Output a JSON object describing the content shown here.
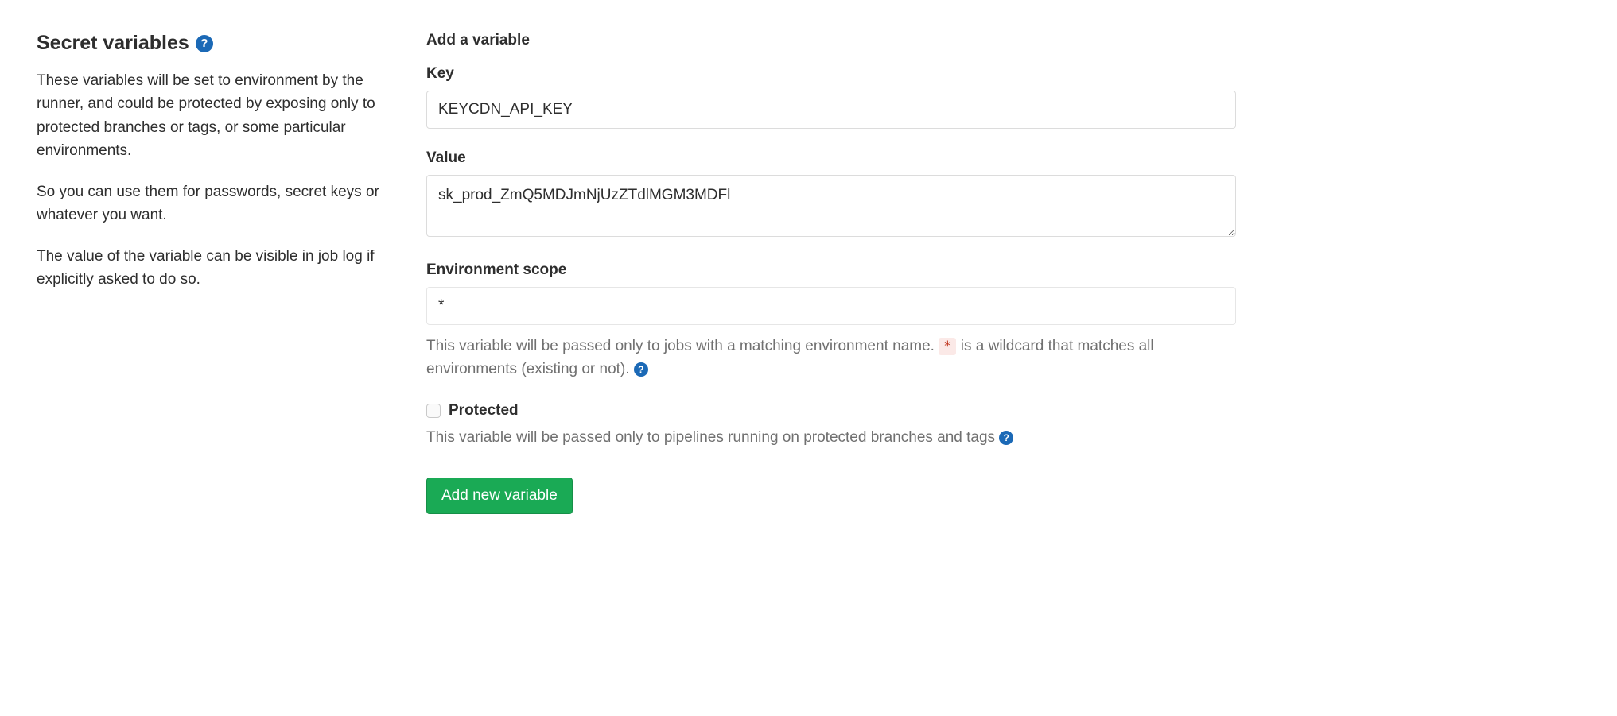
{
  "left": {
    "title": "Secret variables",
    "para1": "These variables will be set to environment by the runner, and could be protected by exposing only to protected branches or tags, or some particular environments.",
    "para2": "So you can use them for passwords, secret keys or whatever you want.",
    "para3": "The value of the variable can be visible in job log if explicitly asked to do so."
  },
  "form": {
    "title": "Add a variable",
    "key_label": "Key",
    "key_value": "KEYCDN_API_KEY",
    "value_label": "Value",
    "value_value": "sk_prod_ZmQ5MDJmNjUzZTdlMGM3MDFl",
    "env_label": "Environment scope",
    "env_value": "*",
    "env_help_pre": "This variable will be passed only to jobs with a matching environment name. ",
    "env_wildcard": "*",
    "env_help_post": " is a wildcard that matches all environments (existing or not). ",
    "protected_label": "Protected",
    "protected_help": "This variable will be passed only to pipelines running on protected branches and tags ",
    "submit_label": "Add new variable"
  }
}
